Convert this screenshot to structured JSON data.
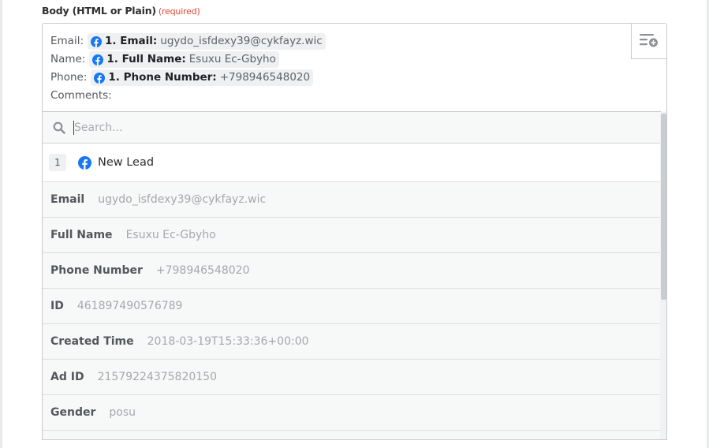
{
  "field": {
    "label": "Body (HTML or Plain)",
    "required_text": "(required)"
  },
  "editor": {
    "lines": [
      {
        "prefix": "Email:",
        "chip": {
          "icon": "facebook-icon",
          "key": "1. Email:",
          "value": "ugydo_isfdexy39@cykfayz.wic"
        }
      },
      {
        "prefix": "Name:",
        "chip": {
          "icon": "facebook-icon",
          "key": "1. Full Name:",
          "value": "Esuxu Ec-Gbyho"
        }
      },
      {
        "prefix": "Phone:",
        "chip": {
          "icon": "facebook-icon",
          "key": "1. Phone Number:",
          "value": "+798946548020"
        }
      },
      {
        "prefix": "Comments:"
      }
    ],
    "insert_button_icon": "insert-field-icon"
  },
  "dropdown": {
    "search": {
      "placeholder": "Search...",
      "value": ""
    },
    "step": {
      "number": "1",
      "icon": "facebook-icon",
      "name": "New Lead"
    },
    "items": [
      {
        "key": "Email",
        "value": "ugydo_isfdexy39@cykfayz.wic"
      },
      {
        "key": "Full Name",
        "value": "Esuxu Ec-Gbyho"
      },
      {
        "key": "Phone Number",
        "value": "+798946548020"
      },
      {
        "key": "ID",
        "value": "461897490576789"
      },
      {
        "key": "Created Time",
        "value": "2018-03-19T15:33:36+00:00"
      },
      {
        "key": "Ad ID",
        "value": "21579224375820150"
      },
      {
        "key": "Gender",
        "value": "posu"
      }
    ]
  },
  "colors": {
    "facebook": "#1877f2",
    "required": "#e5452f"
  }
}
